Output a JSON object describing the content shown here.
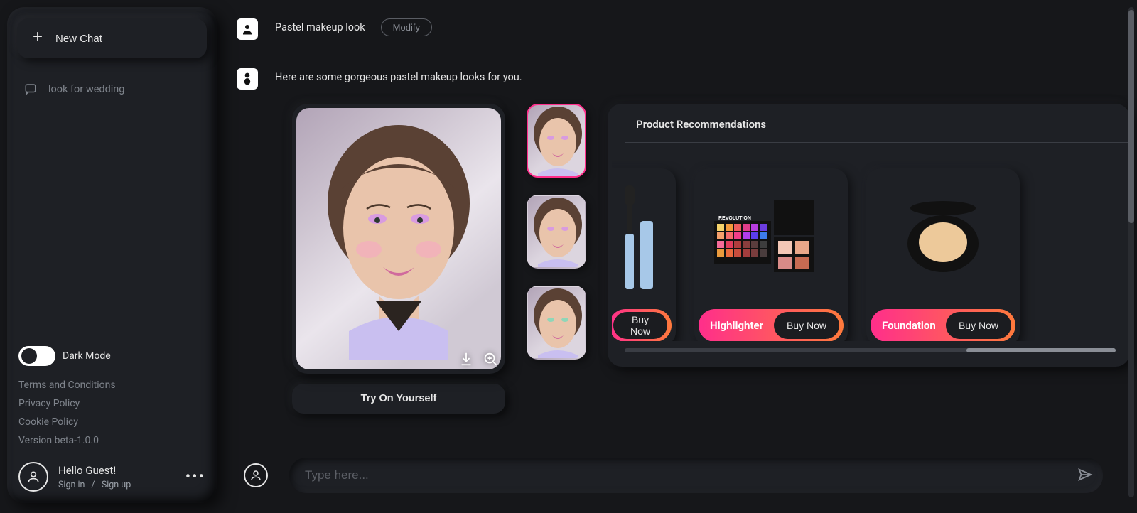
{
  "sidebar": {
    "new_chat_label": "New Chat",
    "history": [
      {
        "label": "look for wedding"
      }
    ],
    "dark_mode_label": "Dark Mode",
    "dark_mode_on": false,
    "links": {
      "terms": "Terms and Conditions",
      "privacy": "Privacy Policy",
      "cookie": "Cookie Policy"
    },
    "version": "Version beta-1.0.0",
    "greeting": "Hello Guest!",
    "signin": "Sign in",
    "sep": "/",
    "signup": "Sign up"
  },
  "conversation": {
    "user_prompt": "Pastel makeup look",
    "modify_label": "Modify",
    "bot_reply": "Here are some gorgeous pastel makeup looks for you."
  },
  "result": {
    "try_on_label": "Try On Yourself",
    "selected_thumb_index": 0
  },
  "products": {
    "title": "Product Recommendations",
    "buy_label": "Buy Now",
    "items": [
      {
        "name": "",
        "kind": "mascara",
        "partial": true
      },
      {
        "name": "Highlighter",
        "kind": "palette",
        "partial": false
      },
      {
        "name": "Foundation",
        "kind": "compact",
        "partial": false
      }
    ]
  },
  "composer": {
    "placeholder": "Type here..."
  }
}
